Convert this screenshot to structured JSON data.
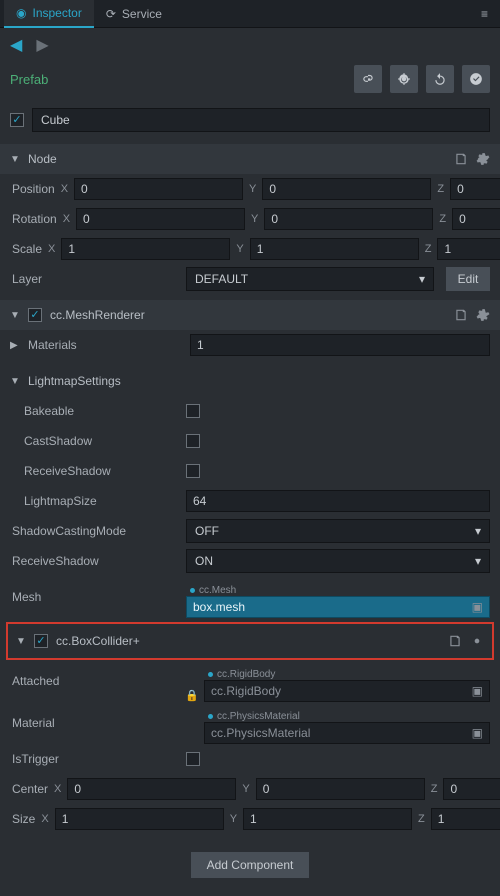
{
  "tabs": {
    "inspector": "Inspector",
    "service": "Service"
  },
  "prefab": {
    "label": "Prefab"
  },
  "objectName": "Cube",
  "node": {
    "title": "Node",
    "position": {
      "label": "Position",
      "x": "0",
      "y": "0",
      "z": "0"
    },
    "rotation": {
      "label": "Rotation",
      "x": "0",
      "y": "0",
      "z": "0"
    },
    "scale": {
      "label": "Scale",
      "x": "1",
      "y": "1",
      "z": "1"
    },
    "layer": {
      "label": "Layer",
      "value": "DEFAULT",
      "editBtn": "Edit"
    }
  },
  "meshRenderer": {
    "title": "cc.MeshRenderer",
    "materials": {
      "label": "Materials",
      "value": "1"
    },
    "lightmapSettings": {
      "title": "LightmapSettings",
      "bakeable": "Bakeable",
      "castShadow": "CastShadow",
      "receiveShadow": "ReceiveShadow",
      "lightmapSize": {
        "label": "LightmapSize",
        "value": "64"
      }
    },
    "shadowCastingMode": {
      "label": "ShadowCastingMode",
      "value": "OFF"
    },
    "receiveShadow2": {
      "label": "ReceiveShadow",
      "value": "ON"
    },
    "mesh": {
      "label": "Mesh",
      "type": "cc.Mesh",
      "value": "box.mesh"
    }
  },
  "boxCollider": {
    "title": "cc.BoxCollider+",
    "attached": {
      "label": "Attached",
      "type": "cc.RigidBody",
      "value": "cc.RigidBody"
    },
    "material": {
      "label": "Material",
      "type": "cc.PhysicsMaterial",
      "value": "cc.PhysicsMaterial"
    },
    "isTrigger": {
      "label": "IsTrigger"
    },
    "center": {
      "label": "Center",
      "x": "0",
      "y": "0",
      "z": "0"
    },
    "size": {
      "label": "Size",
      "x": "1",
      "y": "1",
      "z": "1"
    }
  },
  "addComponent": "Add Component"
}
